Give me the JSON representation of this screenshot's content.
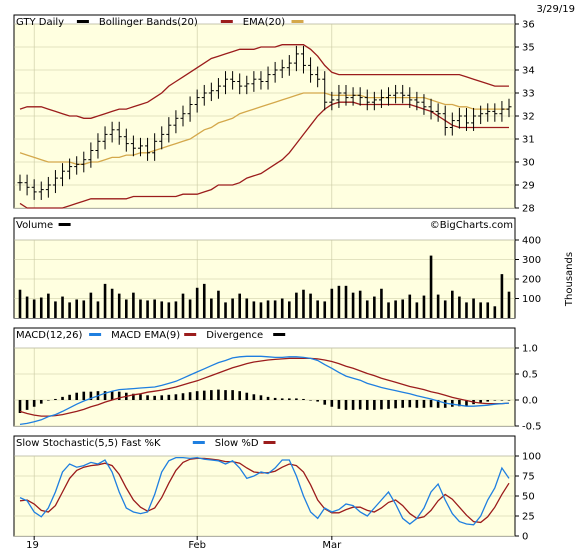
{
  "chart_data": [
    {
      "type": "ohlc",
      "panel": "price",
      "symbol_label": "GTY Daily",
      "date_label": "3/29/19",
      "legend": [
        "GTY Daily",
        "Bollinger Bands(20)",
        "EMA(20)"
      ],
      "ylim": [
        28,
        36
      ],
      "yticks": [
        28,
        29,
        30,
        31,
        32,
        33,
        34,
        35,
        36
      ],
      "grid": true,
      "colors": {
        "bars": "#000000",
        "bollinger": "#9b1c1c",
        "ema": "#d4a84b",
        "background": "#ffffe0"
      },
      "x_ticks": [
        "19",
        "Feb",
        "Mar"
      ],
      "close": [
        29.1,
        28.9,
        28.7,
        28.8,
        29.0,
        29.3,
        29.6,
        29.8,
        29.9,
        30.1,
        30.5,
        30.9,
        31.2,
        31.4,
        31.1,
        30.8,
        30.6,
        30.7,
        30.4,
        30.9,
        31.2,
        31.6,
        31.9,
        32.1,
        32.5,
        32.8,
        33.0,
        33.1,
        33.3,
        33.6,
        33.5,
        33.3,
        33.4,
        33.6,
        33.5,
        33.8,
        34.0,
        34.1,
        34.3,
        34.7,
        34.2,
        33.8,
        33.6,
        32.6,
        32.7,
        33.0,
        32.8,
        32.9,
        32.8,
        32.6,
        32.7,
        32.8,
        32.9,
        33.0,
        32.9,
        32.7,
        32.6,
        32.4,
        32.2,
        32.1,
        31.5,
        31.8,
        32.0,
        31.7,
        32.0,
        32.1,
        32.2,
        32.1,
        32.3,
        32.4
      ],
      "bollinger_upper": [
        32.3,
        32.4,
        32.4,
        32.4,
        32.3,
        32.2,
        32.1,
        32.0,
        32.0,
        31.9,
        31.9,
        32.0,
        32.1,
        32.2,
        32.3,
        32.3,
        32.4,
        32.5,
        32.6,
        32.8,
        33.0,
        33.3,
        33.5,
        33.7,
        33.9,
        34.1,
        34.3,
        34.5,
        34.6,
        34.7,
        34.8,
        34.9,
        34.9,
        34.9,
        35.0,
        35.0,
        35.0,
        35.1,
        35.1,
        35.1,
        35.1,
        34.9,
        34.6,
        34.2,
        33.9,
        33.8,
        33.8,
        33.8,
        33.8,
        33.8,
        33.8,
        33.8,
        33.8,
        33.8,
        33.8,
        33.8,
        33.8,
        33.8,
        33.8,
        33.8,
        33.8,
        33.8,
        33.8,
        33.7,
        33.6,
        33.5,
        33.4,
        33.3,
        33.3,
        33.3
      ],
      "bollinger_lower": [
        28.2,
        28.0,
        28.0,
        28.0,
        28.0,
        28.0,
        28.0,
        28.1,
        28.2,
        28.3,
        28.4,
        28.4,
        28.4,
        28.4,
        28.4,
        28.4,
        28.5,
        28.5,
        28.5,
        28.5,
        28.5,
        28.5,
        28.5,
        28.6,
        28.6,
        28.6,
        28.7,
        28.8,
        29.0,
        29.0,
        29.0,
        29.1,
        29.3,
        29.4,
        29.5,
        29.7,
        29.9,
        30.1,
        30.4,
        30.8,
        31.2,
        31.6,
        32.0,
        32.3,
        32.5,
        32.6,
        32.6,
        32.6,
        32.5,
        32.5,
        32.5,
        32.5,
        32.5,
        32.5,
        32.5,
        32.5,
        32.4,
        32.3,
        32.2,
        32.0,
        31.8,
        31.6,
        31.5,
        31.5,
        31.5,
        31.5,
        31.5,
        31.5,
        31.5,
        31.5
      ],
      "ema": [
        30.4,
        30.3,
        30.2,
        30.1,
        30.0,
        30.0,
        30.0,
        30.0,
        29.9,
        29.9,
        30.0,
        30.0,
        30.1,
        30.2,
        30.2,
        30.3,
        30.3,
        30.4,
        30.4,
        30.5,
        30.6,
        30.7,
        30.8,
        30.9,
        31.0,
        31.2,
        31.4,
        31.5,
        31.7,
        31.8,
        31.9,
        32.1,
        32.2,
        32.3,
        32.4,
        32.5,
        32.6,
        32.7,
        32.8,
        32.9,
        33.0,
        33.0,
        33.0,
        33.0,
        32.9,
        32.9,
        32.9,
        32.9,
        32.9,
        32.8,
        32.8,
        32.8,
        32.8,
        32.8,
        32.8,
        32.8,
        32.8,
        32.8,
        32.7,
        32.6,
        32.5,
        32.5,
        32.4,
        32.4,
        32.3,
        32.3,
        32.3,
        32.3,
        32.3,
        32.3
      ]
    },
    {
      "type": "bar",
      "panel": "volume",
      "legend": [
        "Volume"
      ],
      "watermark": "©BigCharts.com",
      "ylabel": "Thousands",
      "ylim": [
        0,
        400
      ],
      "yticks": [
        100,
        200,
        300,
        400
      ],
      "grid": true,
      "colors": {
        "bars": "#000000",
        "background": "#ffffe0"
      },
      "values": [
        145,
        110,
        95,
        105,
        125,
        85,
        110,
        80,
        95,
        90,
        130,
        85,
        175,
        150,
        125,
        95,
        130,
        95,
        90,
        95,
        85,
        80,
        85,
        125,
        95,
        155,
        175,
        100,
        140,
        80,
        100,
        125,
        100,
        85,
        80,
        90,
        90,
        100,
        85,
        130,
        145,
        125,
        90,
        85,
        150,
        165,
        165,
        130,
        140,
        90,
        110,
        150,
        80,
        90,
        95,
        120,
        80,
        115,
        320,
        120,
        90,
        140,
        110,
        80,
        100,
        80,
        80,
        60,
        225,
        135
      ]
    },
    {
      "type": "line",
      "panel": "macd",
      "legend": [
        "MACD(12,26)",
        "MACD EMA(9)",
        "Divergence"
      ],
      "ylim": [
        -0.5,
        1.0
      ],
      "yticks": [
        1.0,
        0.5,
        0.0,
        -0.5
      ],
      "ytick_labels": [
        "1.0",
        "0.5",
        "0.0",
        "-0.5"
      ],
      "grid": true,
      "colors": {
        "macd": "#1f7fe0",
        "ema": "#9b1c1c",
        "divergence": "#000000",
        "background": "#ffffe0"
      },
      "macd": [
        -0.47,
        -0.45,
        -0.42,
        -0.38,
        -0.32,
        -0.28,
        -0.22,
        -0.15,
        -0.08,
        -0.02,
        0.03,
        0.08,
        0.13,
        0.17,
        0.2,
        0.21,
        0.22,
        0.23,
        0.24,
        0.25,
        0.28,
        0.32,
        0.36,
        0.42,
        0.48,
        0.54,
        0.6,
        0.66,
        0.72,
        0.76,
        0.81,
        0.83,
        0.84,
        0.84,
        0.84,
        0.83,
        0.82,
        0.82,
        0.83,
        0.83,
        0.82,
        0.8,
        0.76,
        0.68,
        0.61,
        0.53,
        0.46,
        0.42,
        0.38,
        0.32,
        0.28,
        0.24,
        0.21,
        0.18,
        0.15,
        0.12,
        0.08,
        0.05,
        0.02,
        -0.02,
        -0.06,
        -0.08,
        -0.1,
        -0.12,
        -0.12,
        -0.11,
        -0.1,
        -0.08,
        -0.07,
        -0.06
      ],
      "signal": [
        -0.22,
        -0.26,
        -0.29,
        -0.31,
        -0.31,
        -0.3,
        -0.28,
        -0.25,
        -0.22,
        -0.18,
        -0.13,
        -0.09,
        -0.04,
        0.0,
        0.04,
        0.07,
        0.1,
        0.12,
        0.15,
        0.17,
        0.19,
        0.22,
        0.25,
        0.29,
        0.33,
        0.37,
        0.42,
        0.47,
        0.52,
        0.57,
        0.62,
        0.66,
        0.7,
        0.73,
        0.75,
        0.77,
        0.78,
        0.79,
        0.8,
        0.8,
        0.8,
        0.8,
        0.79,
        0.77,
        0.74,
        0.7,
        0.65,
        0.61,
        0.56,
        0.51,
        0.47,
        0.42,
        0.38,
        0.34,
        0.3,
        0.26,
        0.23,
        0.2,
        0.16,
        0.13,
        0.09,
        0.05,
        0.02,
        -0.01,
        -0.04,
        -0.06,
        -0.07,
        -0.07,
        -0.07,
        -0.06
      ],
      "divergence": [
        -0.25,
        -0.19,
        -0.13,
        -0.07,
        -0.01,
        0.02,
        0.06,
        0.1,
        0.14,
        0.16,
        0.16,
        0.17,
        0.17,
        0.17,
        0.16,
        0.14,
        0.12,
        0.11,
        0.09,
        0.08,
        0.09,
        0.1,
        0.11,
        0.13,
        0.15,
        0.17,
        0.18,
        0.19,
        0.2,
        0.19,
        0.19,
        0.17,
        0.14,
        0.11,
        0.09,
        0.06,
        0.04,
        0.03,
        0.03,
        0.03,
        0.02,
        0.0,
        -0.03,
        -0.09,
        -0.13,
        -0.17,
        -0.19,
        -0.19,
        -0.18,
        -0.19,
        -0.19,
        -0.18,
        -0.17,
        -0.16,
        -0.15,
        -0.14,
        -0.15,
        -0.15,
        -0.14,
        -0.15,
        -0.15,
        -0.13,
        -0.12,
        -0.11,
        -0.08,
        -0.05,
        -0.03,
        -0.01,
        0.0,
        0.0
      ]
    },
    {
      "type": "line",
      "panel": "stochastic",
      "legend": [
        "Slow Stochastic(5,5)",
        "Fast %K",
        "Slow %D"
      ],
      "ylim": [
        0,
        100
      ],
      "yticks": [
        100,
        75,
        50,
        25,
        0
      ],
      "grid": true,
      "colors": {
        "k": "#1f7fe0",
        "d": "#9b1c1c",
        "background": "#ffffe0"
      },
      "k": [
        48,
        44,
        30,
        24,
        35,
        55,
        80,
        90,
        86,
        88,
        92,
        90,
        95,
        80,
        55,
        35,
        30,
        28,
        30,
        52,
        80,
        94,
        98,
        98,
        97,
        98,
        96,
        95,
        94,
        90,
        94,
        85,
        72,
        75,
        80,
        78,
        85,
        95,
        95,
        75,
        50,
        30,
        22,
        35,
        30,
        33,
        40,
        38,
        30,
        25,
        35,
        45,
        55,
        40,
        22,
        15,
        22,
        35,
        55,
        65,
        45,
        28,
        18,
        15,
        14,
        25,
        45,
        60,
        85,
        72
      ],
      "d": [
        44,
        45,
        40,
        32,
        30,
        38,
        55,
        72,
        82,
        86,
        88,
        89,
        91,
        88,
        77,
        60,
        45,
        36,
        31,
        35,
        48,
        66,
        82,
        92,
        96,
        97,
        97,
        96,
        95,
        93,
        93,
        91,
        85,
        80,
        79,
        79,
        81,
        86,
        90,
        88,
        80,
        64,
        45,
        34,
        29,
        29,
        33,
        36,
        36,
        32,
        30,
        35,
        42,
        45,
        38,
        28,
        22,
        24,
        32,
        44,
        52,
        46,
        36,
        26,
        18,
        17,
        24,
        36,
        52,
        66
      ]
    }
  ]
}
